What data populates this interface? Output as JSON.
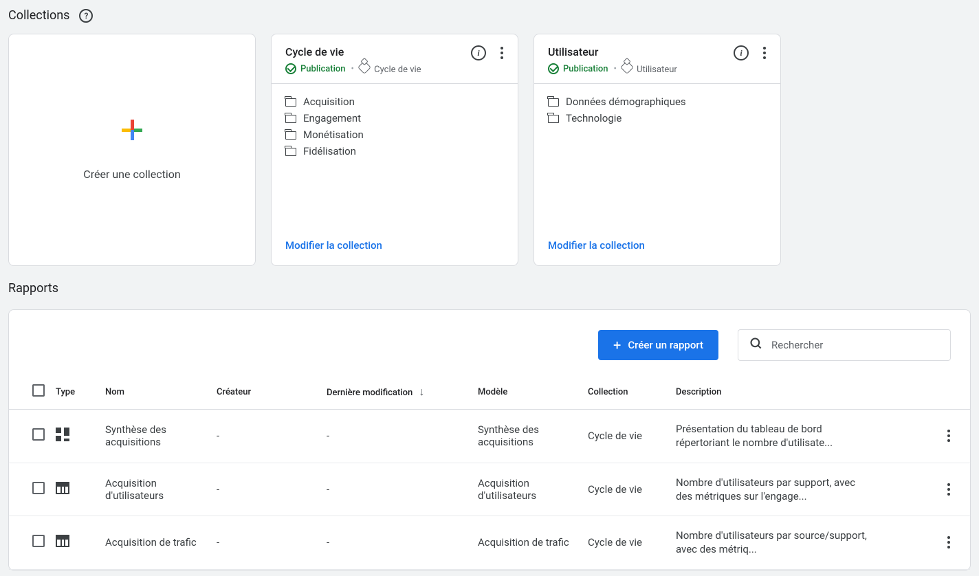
{
  "sections": {
    "collections_title": "Collections",
    "reports_title": "Rapports"
  },
  "create_card": {
    "label": "Créer une collection"
  },
  "shared": {
    "publication_label": "Publication",
    "edit_label": "Modifier la collection"
  },
  "collection_cards": [
    {
      "title": "Cycle de vie",
      "template_label": "Cycle de vie",
      "items": [
        "Acquisition",
        "Engagement",
        "Monétisation",
        "Fidélisation"
      ]
    },
    {
      "title": "Utilisateur",
      "template_label": "Utilisateur",
      "items": [
        "Données démographiques",
        "Technologie"
      ]
    }
  ],
  "toolbar": {
    "create_report": "Créer un rapport",
    "search_placeholder": "Rechercher"
  },
  "table": {
    "headers": {
      "type": "Type",
      "nom": "Nom",
      "createur": "Créateur",
      "modif": "Dernière modification",
      "modele": "Modèle",
      "collection": "Collection",
      "description": "Description"
    },
    "rows": [
      {
        "type_icon": "dashboard",
        "nom": "Synthèse des acquisitions",
        "createur": "-",
        "modif": "-",
        "modele": "Synthèse des acquisitions",
        "collection": "Cycle de vie",
        "description": "Présentation du tableau de bord répertoriant le nombre d'utilisate..."
      },
      {
        "type_icon": "detail",
        "nom": "Acquisition d'utilisateurs",
        "createur": "-",
        "modif": "-",
        "modele": "Acquisition d'utilisateurs",
        "collection": "Cycle de vie",
        "description": "Nombre d'utilisateurs par support, avec des métriques sur l'engage..."
      },
      {
        "type_icon": "detail",
        "nom": "Acquisition de trafic",
        "createur": "-",
        "modif": "-",
        "modele": "Acquisition de trafic",
        "collection": "Cycle de vie",
        "description": "Nombre d'utilisateurs par source/support, avec des métriq..."
      }
    ]
  }
}
